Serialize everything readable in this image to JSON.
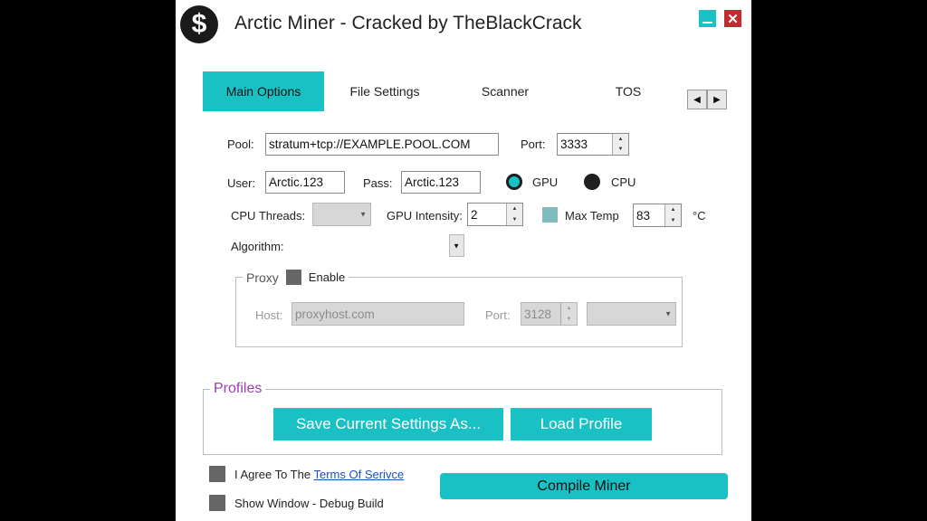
{
  "window": {
    "title": "Arctic Miner - Cracked by TheBlackCrack",
    "logo_glyph": "$",
    "close_glyph": "✕"
  },
  "tabs": [
    {
      "label": "Main Options",
      "active": true
    },
    {
      "label": "File Settings",
      "active": false
    },
    {
      "label": "Scanner",
      "active": false
    },
    {
      "label": "TOS",
      "active": false
    }
  ],
  "tab_scroll": {
    "left_icon": "◀",
    "right_icon": "▶"
  },
  "main": {
    "pool_label": "Pool:",
    "pool_value": "stratum+tcp://EXAMPLE.POOL.COM",
    "port_label": "Port:",
    "port_value": "3333",
    "user_label": "User:",
    "user_value": "Arctic.123",
    "pass_label": "Pass:",
    "pass_value": "Arctic.123",
    "gpu_label": "GPU",
    "cpu_label": "CPU",
    "selected_device": "GPU",
    "cpu_threads_label": "CPU Threads:",
    "gpu_intensity_label": "GPU Intensity:",
    "gpu_intensity_value": "2",
    "max_temp_label": "Max Temp",
    "max_temp_checked": true,
    "max_temp_value": "83",
    "temp_unit": "°C",
    "algorithm_label": "Algorithm:"
  },
  "proxy": {
    "group_label": "Proxy",
    "enable_label": "Enable",
    "enabled": false,
    "host_label": "Host:",
    "host_placeholder": "proxyhost.com",
    "port_label": "Port:",
    "port_value": "3128"
  },
  "profiles": {
    "group_label": "Profiles",
    "save_label": "Save Current Settings As...",
    "load_label": "Load Profile"
  },
  "footer": {
    "agree_text": "I Agree To The",
    "terms_link": "Terms Of Serivce",
    "show_window_label": "Show Window - Debug Build",
    "compile_label": "Compile Miner"
  },
  "colors": {
    "accent": "#19c1c5",
    "close": "#c8282f",
    "profiles_label": "#9b3fb5"
  }
}
